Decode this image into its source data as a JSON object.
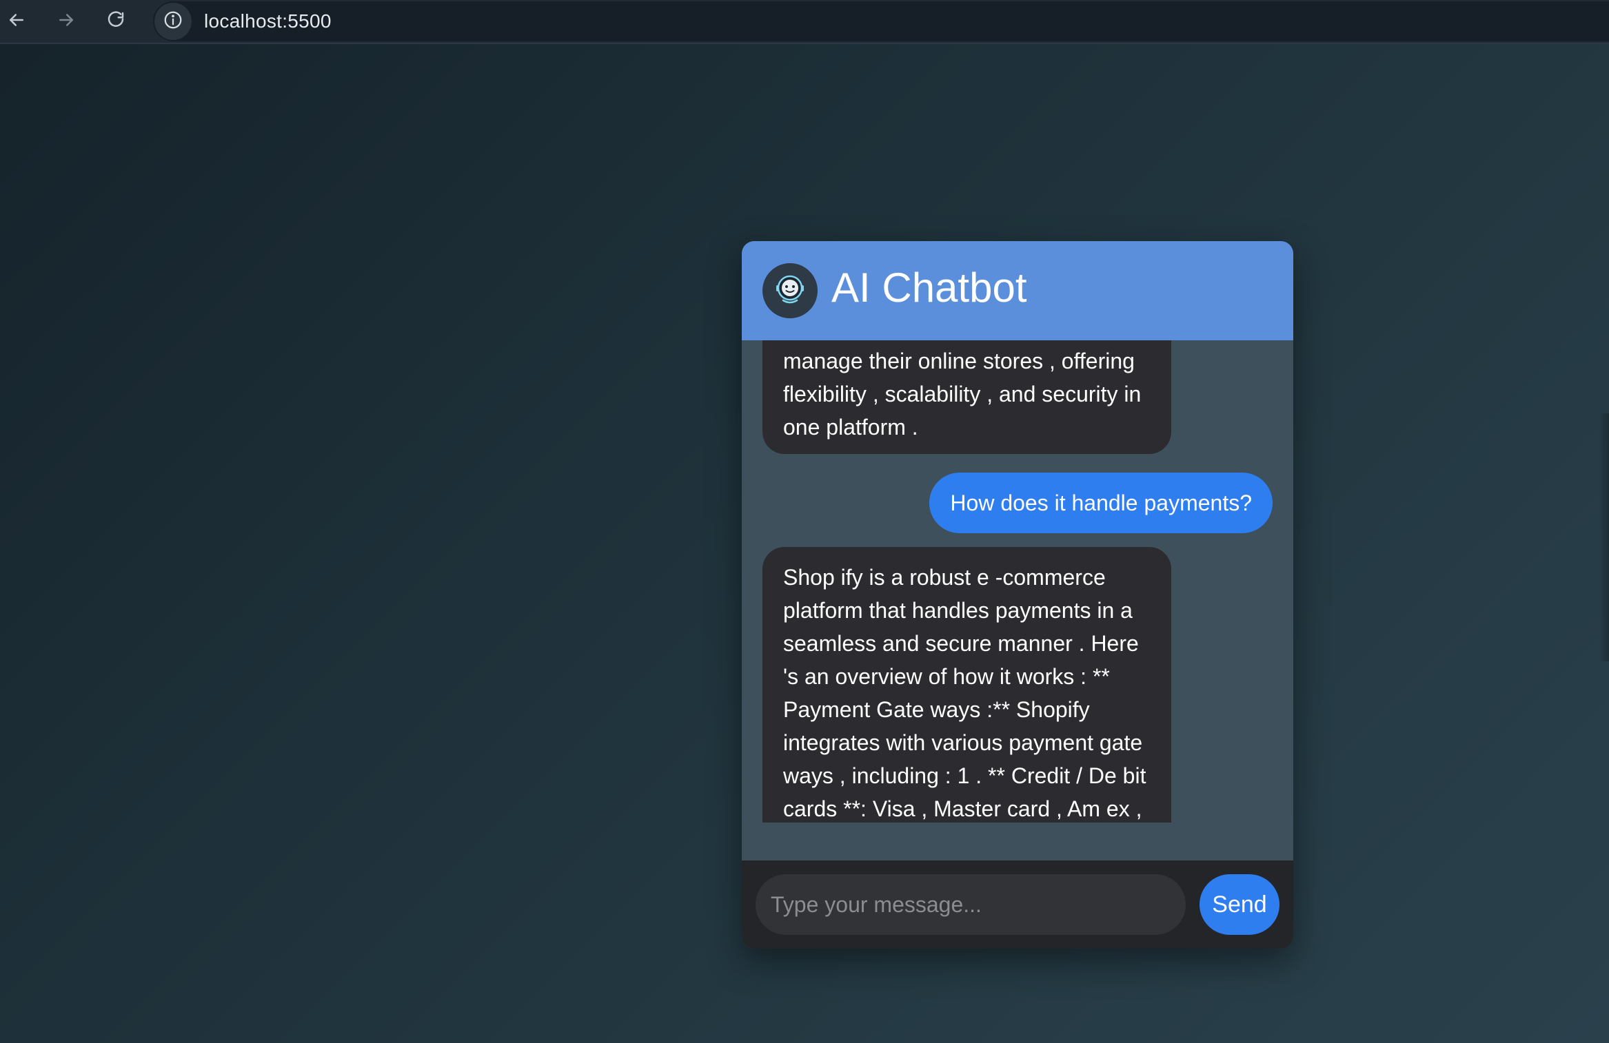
{
  "browser": {
    "url": "localhost:5500",
    "back_icon": "arrow-left-icon",
    "forward_icon": "arrow-right-icon",
    "reload_icon": "reload-icon",
    "site_info_icon": "info-icon"
  },
  "chat": {
    "title": "AI Chatbot",
    "avatar_icon": "robot-icon",
    "messages": [
      {
        "role": "bot",
        "text": "manage their online stores , offering flexibility , scalability , and security in one platform ."
      },
      {
        "role": "user",
        "text": "How does it handle payments?"
      },
      {
        "role": "bot",
        "text": "Shop ify is a robust e -commerce platform that handles payments in a seamless and secure manner . Here 's an overview of how it works : ** Payment Gate ways :** Shopify integrates with various payment gate ways , including : 1 . ** Credit / De bit cards **: Visa , Master card , Am ex ,"
      }
    ],
    "input": {
      "placeholder": "Type your message...",
      "value": ""
    },
    "send_label": "Send"
  },
  "colors": {
    "header": "#5b8fdb",
    "user_bubble": "#2f7ef0",
    "bot_bubble": "#2c2c30",
    "messages_bg": "#3e505b",
    "input_bar": "#242529"
  }
}
